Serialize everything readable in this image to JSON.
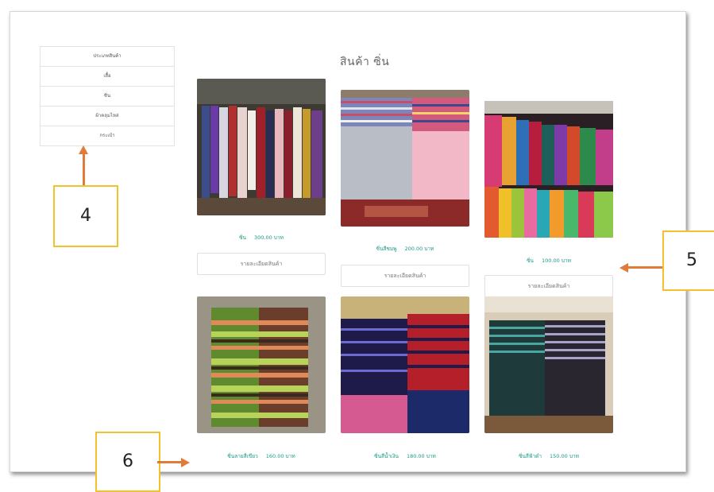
{
  "sidebar": {
    "items": [
      {
        "label": "ประเภทสินค้า"
      },
      {
        "label": "เสื้อ"
      },
      {
        "label": "ซิ่น"
      },
      {
        "label": "ผ้าคลุมไหล่"
      },
      {
        "label": "กระเป๋า"
      }
    ]
  },
  "main": {
    "title": "สินค้า ซิ่น"
  },
  "products": [
    {
      "name": "ซิ่น",
      "price": "300.00 บาท",
      "detail_label": "รายละเอียดสินค้า"
    },
    {
      "name": "ซิ่นสีชมพู",
      "price": "200.00 บาท",
      "detail_label": "รายละเอียดสินค้า"
    },
    {
      "name": "ซิ่น",
      "price": "100.00 บาท",
      "detail_label": "รายละเอียดสินค้า"
    },
    {
      "name": "ซิ่นลายสีเขียว",
      "price": "160.00 บาท"
    },
    {
      "name": "ซิ่นสีน้ำเงิน",
      "price": "180.00 บาท"
    },
    {
      "name": "ซิ่นสีฟ้าดำ",
      "price": "150.00 บาท"
    }
  ],
  "annotations": [
    {
      "label": "4"
    },
    {
      "label": "5"
    },
    {
      "label": "6"
    }
  ],
  "colors": {
    "price_text": "#1a9a86",
    "callout_border": "#f2c12e",
    "arrow": "#e07b39"
  }
}
